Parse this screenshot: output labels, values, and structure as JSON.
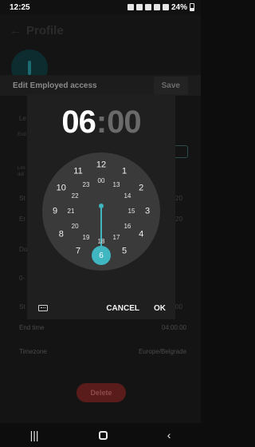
{
  "statusbar": {
    "time": "12:25",
    "battery": "24%"
  },
  "page": {
    "back_title": "Profile",
    "edit_title": "Edit Employed  access",
    "save_label": "Save",
    "fragments": {
      "le": "Le",
      "end": "End",
      "lim": "Lim",
      "dd": "dd/",
      "st1": "St",
      "v1": "20",
      "er": "Er",
      "v2": "20",
      "d": "Do",
      "dash": "0-",
      "st2": "St",
      "v3": "00"
    },
    "end_time_label": "End time",
    "end_time_value": "04:00:00",
    "timezone_label": "Timezone",
    "timezone_value": "Europe/Belgrade",
    "delete_label": "Delete"
  },
  "dialog": {
    "hour": "06",
    "separator": ":",
    "minute": "00",
    "selected": "6",
    "outer_numbers": [
      "12",
      "1",
      "2",
      "3",
      "4",
      "5",
      "6",
      "7",
      "8",
      "9",
      "10",
      "11"
    ],
    "inner_numbers": [
      "00",
      "13",
      "14",
      "15",
      "16",
      "17",
      "18",
      "19",
      "20",
      "21",
      "22",
      "23"
    ],
    "cancel_label": "CANCEL",
    "ok_label": "OK",
    "accent": "#3fb6c0"
  }
}
